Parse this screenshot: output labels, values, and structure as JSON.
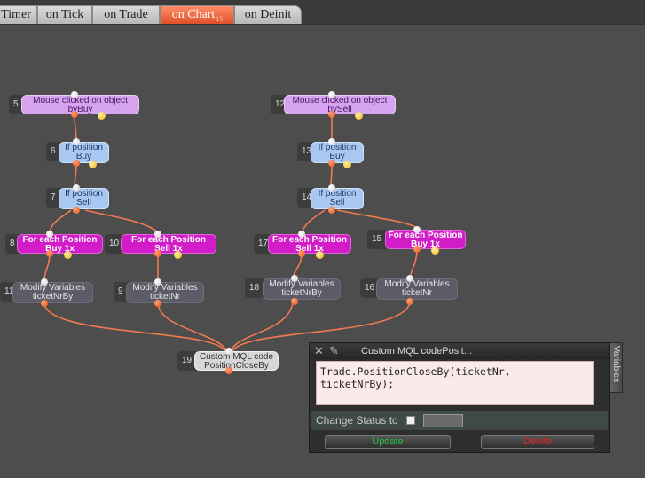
{
  "tabs": [
    {
      "label": "Timer",
      "active": false
    },
    {
      "label": "on Tick",
      "active": false
    },
    {
      "label": "on Trade",
      "active": false
    },
    {
      "label": "on Chart",
      "badge": "15",
      "active": true
    },
    {
      "label": "on Deinit",
      "active": false
    }
  ],
  "nodes": [
    {
      "num": "5",
      "lines": [
        "Mouse clicked on object",
        "byBuy"
      ],
      "kind": "event"
    },
    {
      "num": "6",
      "lines": [
        "If position",
        "Buy"
      ],
      "kind": "condition"
    },
    {
      "num": "7",
      "lines": [
        "If position",
        "Sell"
      ],
      "kind": "condition"
    },
    {
      "num": "8",
      "lines": [
        "For each Position",
        "Buy 1x"
      ],
      "kind": "loop"
    },
    {
      "num": "10",
      "lines": [
        "For each Position",
        "Sell 1x"
      ],
      "kind": "loop"
    },
    {
      "num": "11",
      "lines": [
        "Modify Variables",
        "ticketNrBy"
      ],
      "kind": "action"
    },
    {
      "num": "9",
      "lines": [
        "Modify Variables",
        "ticketNr"
      ],
      "kind": "action"
    },
    {
      "num": "12",
      "lines": [
        "Mouse clicked on object",
        "bySell"
      ],
      "kind": "event"
    },
    {
      "num": "13",
      "lines": [
        "If position",
        "Buy"
      ],
      "kind": "condition"
    },
    {
      "num": "14",
      "lines": [
        "If position",
        "Sell"
      ],
      "kind": "condition"
    },
    {
      "num": "17",
      "lines": [
        "For each Position",
        "Sell 1x"
      ],
      "kind": "loop"
    },
    {
      "num": "15",
      "lines": [
        "For each Position",
        "Buy 1x"
      ],
      "kind": "loop"
    },
    {
      "num": "18",
      "lines": [
        "Modify Variables",
        "ticketNrBy"
      ],
      "kind": "action"
    },
    {
      "num": "16",
      "lines": [
        "Modify Variables",
        "ticketNr"
      ],
      "kind": "action"
    },
    {
      "num": "19",
      "lines": [
        "Custom MQL code",
        "PositionCloseBy"
      ],
      "kind": "custom"
    }
  ],
  "properties_panel": {
    "title": "Custom MQL codePosit...",
    "close_icon": "close-icon",
    "pin_icon": "pin-icon",
    "code": "Trade.PositionCloseBy(ticketNr, ticketNrBy);",
    "change_status_label": "Change Status to",
    "change_status_checked": false,
    "change_status_value": "",
    "update_label": "Update",
    "delete_label": "Delete",
    "update_color": "#22c03a",
    "delete_color": "#e02424"
  },
  "side_tab": {
    "label": "Variables"
  },
  "colors": {
    "link": "#f07a50",
    "event": "#d6a3f0",
    "condition": "#a8c8f2",
    "loop": "#d21cc7",
    "action": "#5c5c68",
    "custom": "#d7d7d7",
    "active_tab": "#e8603a"
  }
}
